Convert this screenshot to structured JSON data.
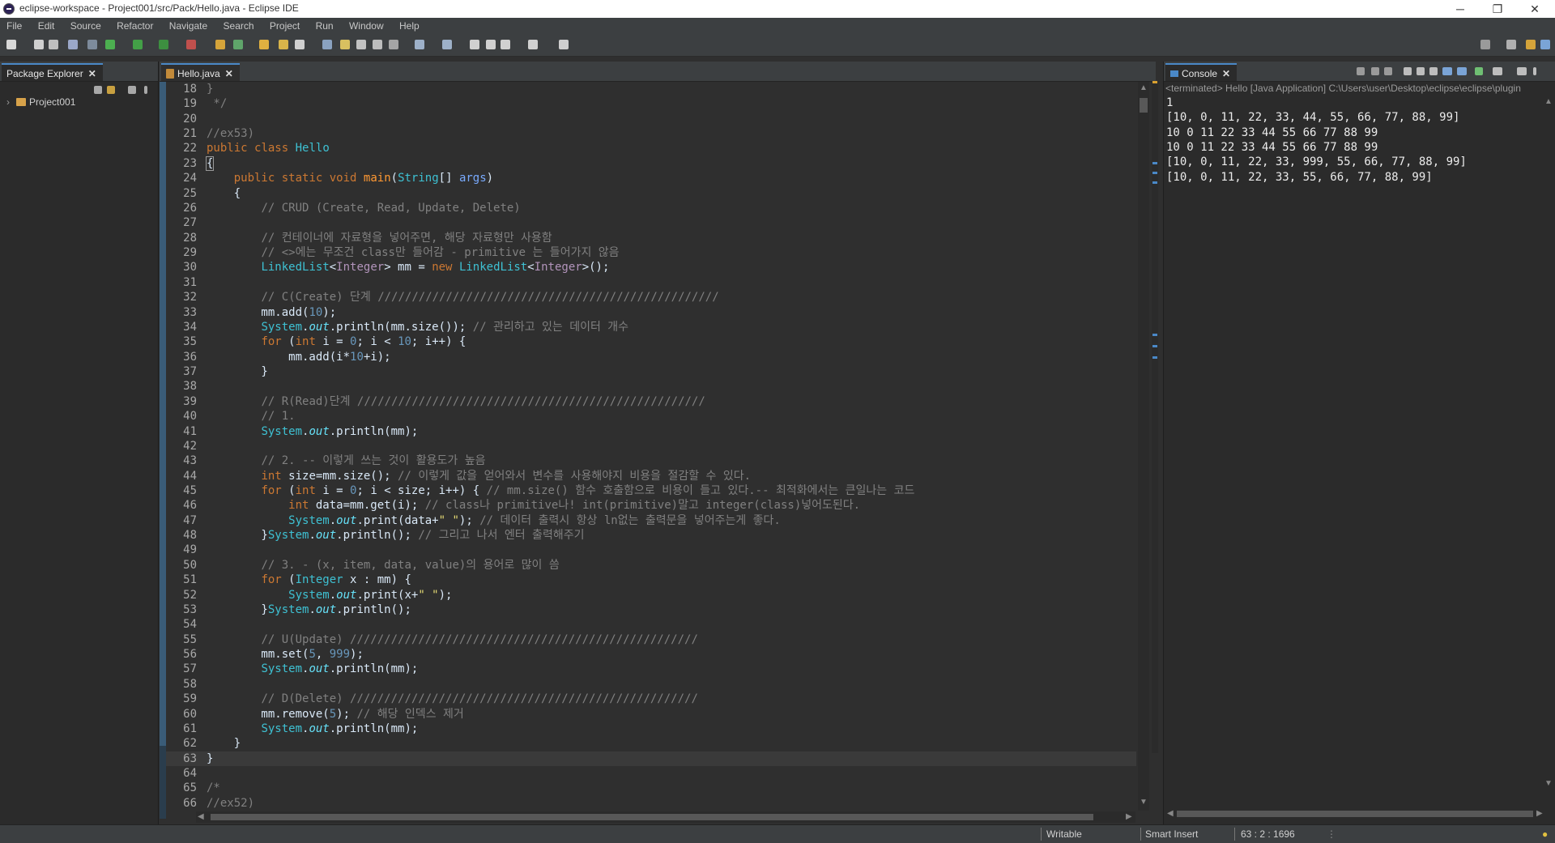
{
  "window": {
    "title": "eclipse-workspace - Project001/src/Pack/Hello.java - Eclipse IDE"
  },
  "window_controls": {
    "minimize": "─",
    "restore": "❐",
    "close": "✕"
  },
  "menubar": [
    "File",
    "Edit",
    "Source",
    "Refactor",
    "Navigate",
    "Search",
    "Project",
    "Run",
    "Window",
    "Help"
  ],
  "package_explorer": {
    "tab_label": "Package Explorer",
    "tree": [
      {
        "label": "Project001",
        "expanded": false
      }
    ]
  },
  "editor": {
    "tab_label": "Hello.java",
    "current_line": 63
  },
  "console": {
    "tab_label": "Console",
    "header": "<terminated> Hello [Java Application] C:\\Users\\user\\Desktop\\eclipse\\eclipse\\plugin",
    "lines": [
      "1",
      "[10, 0, 11, 22, 33, 44, 55, 66, 77, 88, 99]",
      "10 0 11 22 33 44 55 66 77 88 99",
      "10 0 11 22 33 44 55 66 77 88 99",
      "[10, 0, 11, 22, 33, 999, 55, 66, 77, 88, 99]",
      "[10, 0, 11, 22, 33, 55, 66, 77, 88, 99]"
    ]
  },
  "statusbar": {
    "writable": "Writable",
    "insert_mode": "Smart Insert",
    "position": "63 : 2 : 1696"
  },
  "colors": {
    "editor_bg": "#2f2f2f",
    "keyword": "#cc7832",
    "class": "#3ec1d3",
    "comment": "#808080",
    "accent": "#4a88c7"
  }
}
